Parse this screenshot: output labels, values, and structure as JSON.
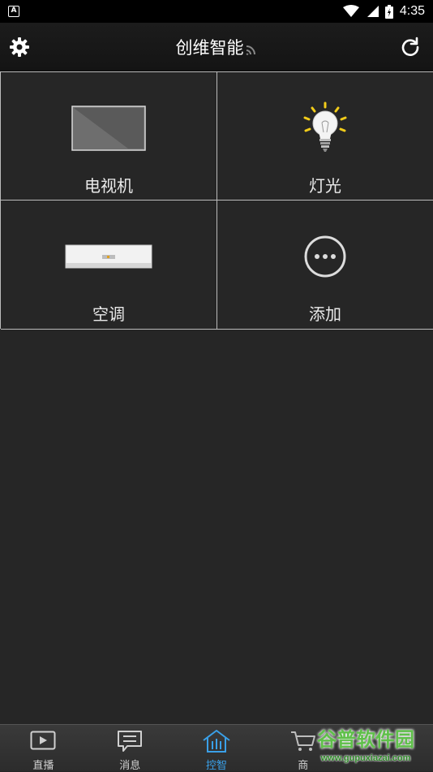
{
  "status_bar": {
    "notification_icon": "A",
    "time": "4:35"
  },
  "header": {
    "title": "创维智能",
    "left_icon": "gear-icon",
    "right_icon": "refresh-icon"
  },
  "devices": [
    {
      "label": "电视机",
      "icon": "tv-icon"
    },
    {
      "label": "灯光",
      "icon": "light-bulb-icon"
    },
    {
      "label": "空调",
      "icon": "air-conditioner-icon"
    },
    {
      "label": "添加",
      "icon": "more-icon"
    }
  ],
  "tabs": [
    {
      "label": "直播",
      "icon": "play-icon",
      "active": false
    },
    {
      "label": "消息",
      "icon": "message-icon",
      "active": false
    },
    {
      "label": "控智",
      "icon": "home-icon",
      "active": true
    },
    {
      "label": "商",
      "icon": "cart-icon",
      "active": false
    },
    {
      "label": "",
      "icon": "",
      "active": false
    }
  ],
  "watermark": {
    "text": "谷普软件园",
    "url": "www.gupuxiazai.com"
  },
  "colors": {
    "background": "#262626",
    "accent": "#3aa0e8",
    "grid_line": "#bbbbbb"
  }
}
